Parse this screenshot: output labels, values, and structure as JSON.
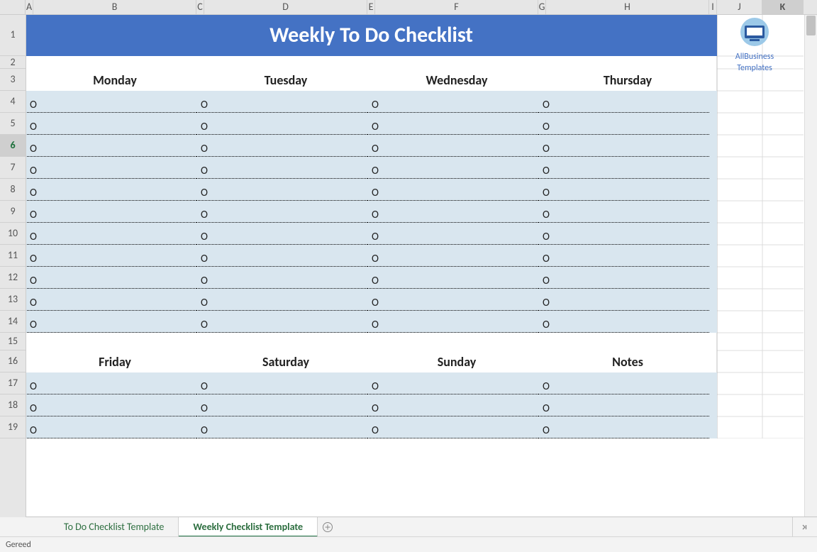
{
  "title": "Weekly To Do Checklist",
  "columns": {
    "labels": [
      "A",
      "B",
      "C",
      "D",
      "E",
      "F",
      "G",
      "H",
      "I",
      "J",
      "K"
    ],
    "widths": [
      11,
      230,
      11,
      230,
      11,
      230,
      11,
      230,
      11,
      64,
      58
    ],
    "selected_index": 10
  },
  "rows": {
    "labels": [
      "1",
      "2",
      "3",
      "4",
      "5",
      "6",
      "7",
      "8",
      "9",
      "10",
      "11",
      "12",
      "13",
      "14",
      "15",
      "16",
      "17",
      "18",
      "19"
    ],
    "heights": [
      59,
      18,
      31,
      31,
      31,
      31,
      31,
      31,
      31,
      31,
      31,
      31,
      31,
      31,
      25,
      31,
      31,
      31,
      31
    ],
    "selected_index": 5
  },
  "section1": {
    "headers": [
      "Monday",
      "Tuesday",
      "Wednesday",
      "Thursday"
    ],
    "rows": 11,
    "bullet": "O"
  },
  "section2": {
    "headers": [
      "Friday",
      "Saturday",
      "Sunday",
      "Notes"
    ],
    "rows": 3,
    "bullet": "O"
  },
  "tabs": {
    "items": [
      "To Do Checklist Template",
      "Weekly Checklist Template"
    ],
    "active_index": 1
  },
  "status_text": "Gereed",
  "logo": {
    "line1": "AllBusiness",
    "line2": "Templates"
  }
}
